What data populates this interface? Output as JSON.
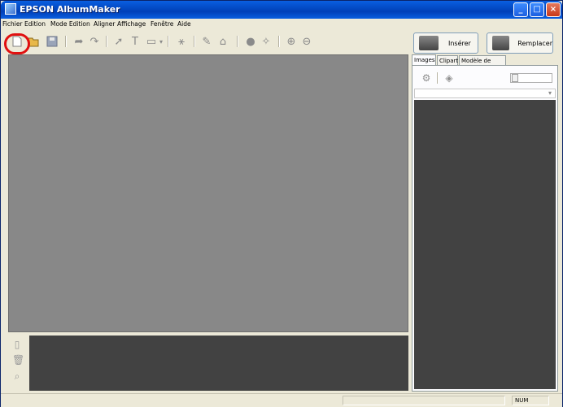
{
  "window": {
    "title": "EPSON AlbumMaker"
  },
  "menu": [
    "Fichier",
    "Edition",
    "Mode Edition",
    "Aligner",
    "Affichage",
    "Fenêtre",
    "Aide"
  ],
  "right_panel": {
    "insert_label": "Insérer",
    "replace_label": "Remplacer",
    "tabs": [
      "Images",
      "Clipart",
      "Modèle de page"
    ],
    "active_tab": "Images"
  },
  "status": {
    "num": "NUM"
  },
  "colors": {
    "highlight": "#e01010",
    "titlebar": "#0a5fe0",
    "canvas": "#888888",
    "dark_panel": "#424242"
  }
}
